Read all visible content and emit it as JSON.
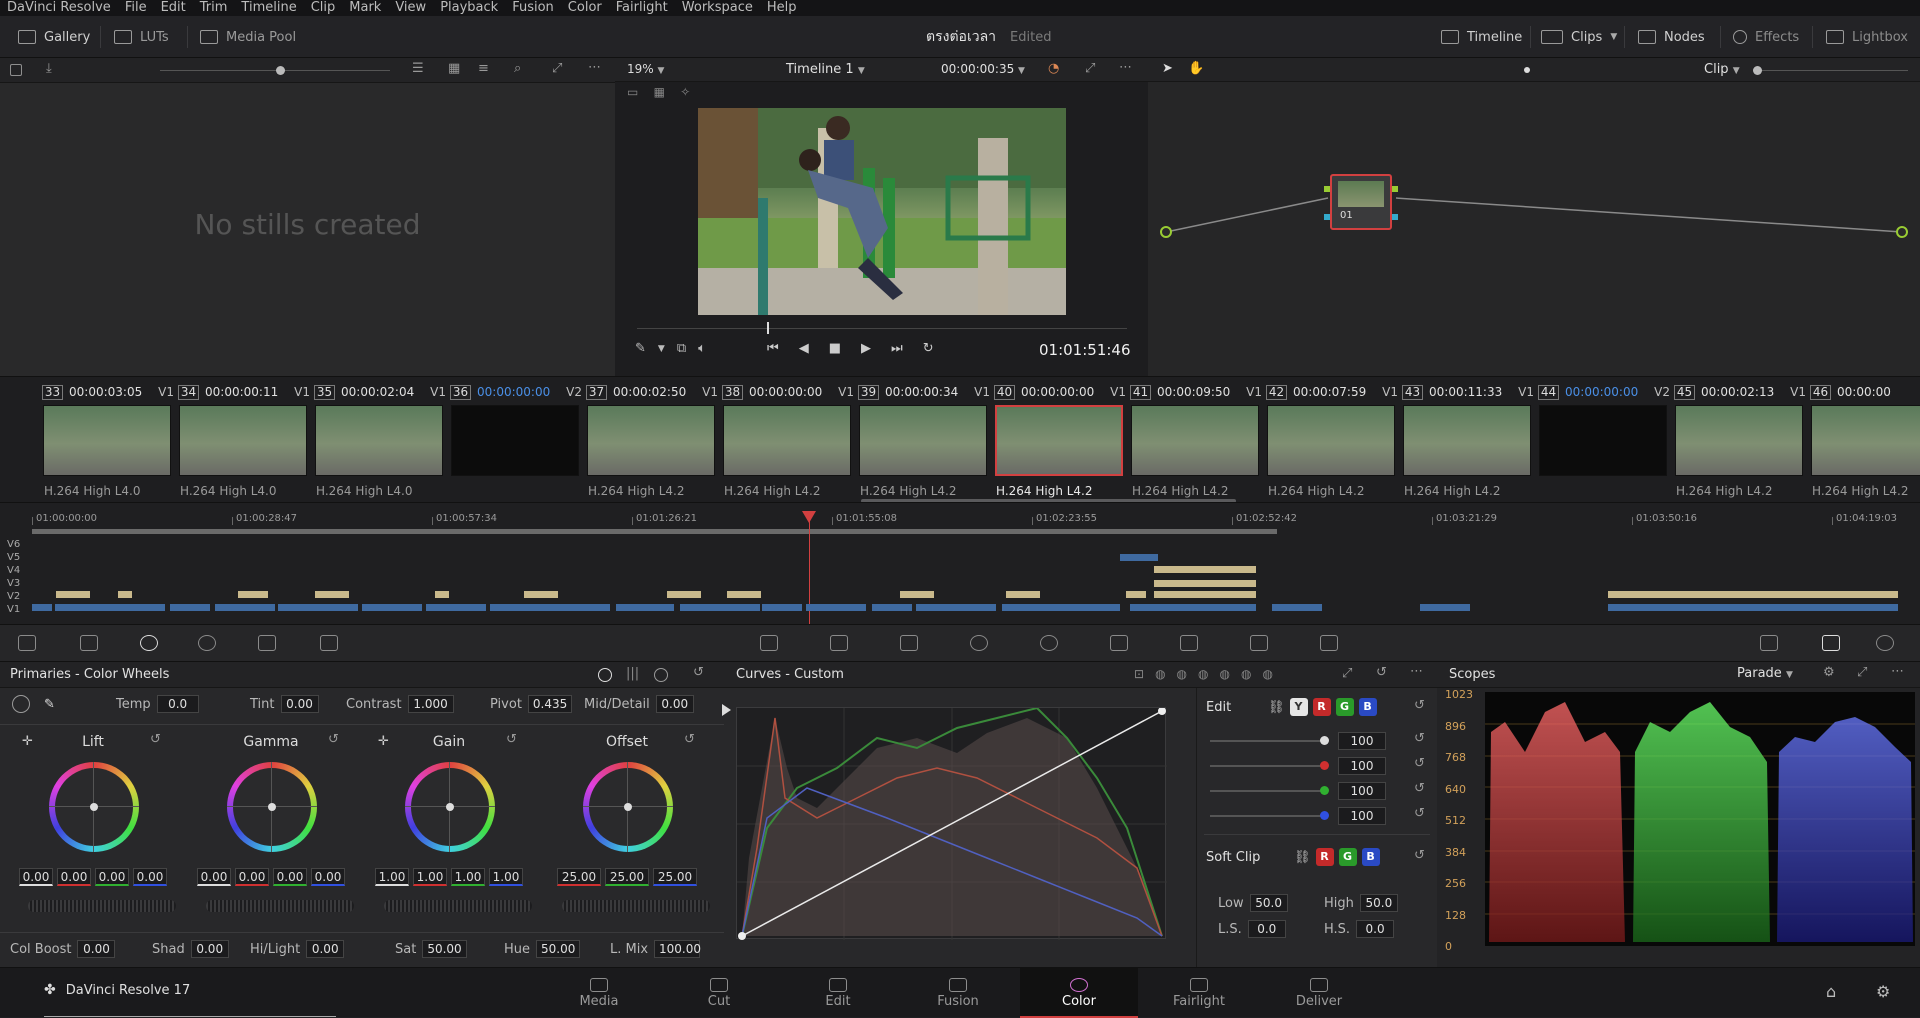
{
  "menubar": [
    "DaVinci Resolve",
    "File",
    "Edit",
    "Trim",
    "Timeline",
    "Clip",
    "Mark",
    "View",
    "Playback",
    "Fusion",
    "Color",
    "Fairlight",
    "Workspace",
    "Help"
  ],
  "toolbar": {
    "gallery": "Gallery",
    "luts": "LUTs",
    "media_pool": "Media Pool",
    "project_name": "ตรงต่อเวลา",
    "edited": "Edited",
    "timeline": "Timeline",
    "clips": "Clips",
    "nodes": "Nodes",
    "effects": "Effects",
    "lightbox": "Lightbox"
  },
  "gallery": {
    "empty_text": "No stills created"
  },
  "viewer": {
    "zoom": "19%",
    "timeline_name": "Timeline 1",
    "duration": "00:00:00:35",
    "timecode": "01:01:51:46"
  },
  "nodes": {
    "mode": "Clip",
    "node_label": "01"
  },
  "clips": [
    {
      "num": "33",
      "tc": "00:00:03:05",
      "trk": "V1",
      "codec": "H.264 High L4.0",
      "black": false,
      "sel": false,
      "blue": false
    },
    {
      "num": "34",
      "tc": "00:00:00:11",
      "trk": "V1",
      "codec": "H.264 High L4.0",
      "black": false,
      "sel": false,
      "blue": false
    },
    {
      "num": "35",
      "tc": "00:00:02:04",
      "trk": "V1",
      "codec": "H.264 High L4.0",
      "black": false,
      "sel": false,
      "blue": false
    },
    {
      "num": "36",
      "tc": "00:00:00:00",
      "trk": "V2",
      "codec": "",
      "black": true,
      "sel": false,
      "blue": true
    },
    {
      "num": "37",
      "tc": "00:00:02:50",
      "trk": "V1",
      "codec": "H.264 High L4.2",
      "black": false,
      "sel": false,
      "blue": false
    },
    {
      "num": "38",
      "tc": "00:00:00:00",
      "trk": "V1",
      "codec": "H.264 High L4.2",
      "black": false,
      "sel": false,
      "blue": false
    },
    {
      "num": "39",
      "tc": "00:00:00:34",
      "trk": "V1",
      "codec": "H.264 High L4.2",
      "black": false,
      "sel": false,
      "blue": false
    },
    {
      "num": "40",
      "tc": "00:00:00:00",
      "trk": "V1",
      "codec": "H.264 High L4.2",
      "black": false,
      "sel": true,
      "blue": false
    },
    {
      "num": "41",
      "tc": "00:00:09:50",
      "trk": "V1",
      "codec": "H.264 High L4.2",
      "black": false,
      "sel": false,
      "blue": false
    },
    {
      "num": "42",
      "tc": "00:00:07:59",
      "trk": "V1",
      "codec": "H.264 High L4.2",
      "black": false,
      "sel": false,
      "blue": false
    },
    {
      "num": "43",
      "tc": "00:00:11:33",
      "trk": "V1",
      "codec": "H.264 High L4.2",
      "black": false,
      "sel": false,
      "blue": false
    },
    {
      "num": "44",
      "tc": "00:00:00:00",
      "trk": "V2",
      "codec": "",
      "black": true,
      "sel": false,
      "blue": true
    },
    {
      "num": "45",
      "tc": "00:00:02:13",
      "trk": "V1",
      "codec": "H.264 High L4.2",
      "black": false,
      "sel": false,
      "blue": false
    },
    {
      "num": "46",
      "tc": "00:00:00",
      "trk": "",
      "codec": "H.264 High L4.2",
      "black": false,
      "sel": false,
      "blue": false
    }
  ],
  "timeline": {
    "ruler": [
      "01:00:00:00",
      "01:00:28:47",
      "01:00:57:34",
      "01:01:26:21",
      "01:01:55:08",
      "01:02:23:55",
      "01:02:52:42",
      "01:03:21:29",
      "01:03:50:16",
      "01:04:19:03"
    ],
    "tracks": [
      "V6",
      "V5",
      "V4",
      "V3",
      "V2",
      "V1"
    ]
  },
  "primaries": {
    "title": "Primaries - Color Wheels",
    "temp_label": "Temp",
    "temp": "0.0",
    "tint_label": "Tint",
    "tint": "0.00",
    "contrast_label": "Contrast",
    "contrast": "1.000",
    "pivot_label": "Pivot",
    "pivot": "0.435",
    "middetail_label": "Mid/Detail",
    "middetail": "0.00",
    "wheels": [
      {
        "name": "Lift",
        "values": [
          "0.00",
          "0.00",
          "0.00",
          "0.00"
        ]
      },
      {
        "name": "Gamma",
        "values": [
          "0.00",
          "0.00",
          "0.00",
          "0.00"
        ]
      },
      {
        "name": "Gain",
        "values": [
          "1.00",
          "1.00",
          "1.00",
          "1.00"
        ]
      },
      {
        "name": "Offset",
        "values": [
          "25.00",
          "25.00",
          "25.00"
        ]
      }
    ],
    "colboost_label": "Col Boost",
    "colboost": "0.00",
    "shad_label": "Shad",
    "shad": "0.00",
    "hilight_label": "Hi/Light",
    "hilight": "0.00",
    "sat_label": "Sat",
    "sat": "50.00",
    "hue_label": "Hue",
    "hue": "50.00",
    "lmix_label": "L. Mix",
    "lmix": "100.00"
  },
  "curves": {
    "title": "Curves - Custom",
    "edit_label": "Edit",
    "channels": [
      "Y",
      "R",
      "G",
      "B"
    ],
    "intensity": [
      "100",
      "100",
      "100",
      "100"
    ],
    "softclip_label": "Soft Clip",
    "low_label": "Low",
    "low": "50.0",
    "high_label": "High",
    "high": "50.0",
    "ls_label": "L.S.",
    "ls": "0.0",
    "hs_label": "H.S.",
    "hs": "0.0"
  },
  "scopes": {
    "title": "Scopes",
    "mode": "Parade",
    "scale": [
      "1023",
      "896",
      "768",
      "640",
      "512",
      "384",
      "256",
      "128",
      "0"
    ]
  },
  "bottomnav": {
    "app": "DaVinci Resolve 17",
    "pages": [
      "Media",
      "Cut",
      "Edit",
      "Fusion",
      "Color",
      "Fairlight",
      "Deliver"
    ],
    "active": "Color"
  },
  "colors": {
    "accent": "#d24040",
    "blue_tc": "#4a8fe6",
    "scale": "#d2a15a"
  }
}
